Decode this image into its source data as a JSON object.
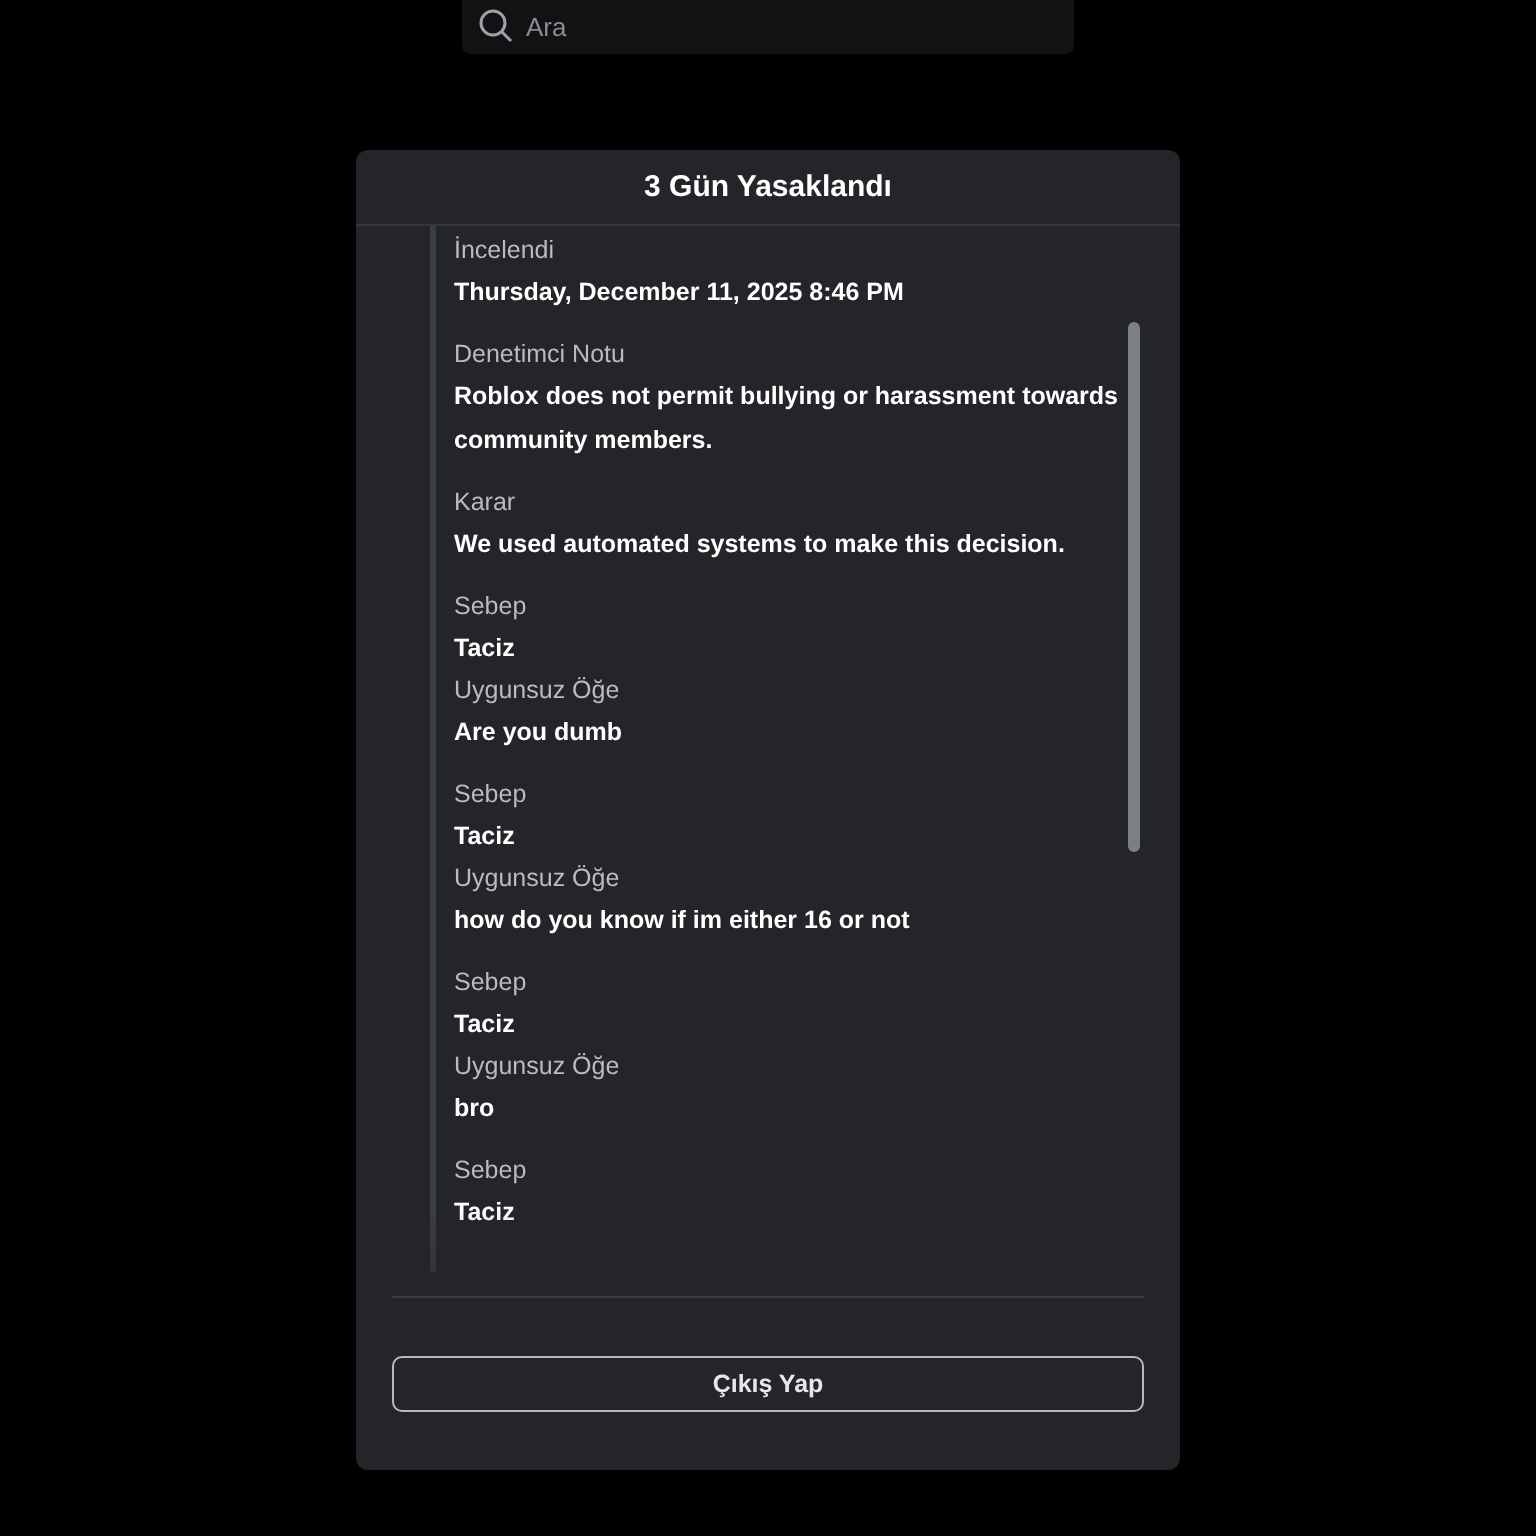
{
  "search": {
    "placeholder": "Ara"
  },
  "dialog": {
    "title": "3 Gün Yasaklandı",
    "groups": [
      {
        "fields": [
          {
            "label": "İncelendi",
            "value": "Thursday, December 11, 2025 8:46 PM"
          }
        ]
      },
      {
        "fields": [
          {
            "label": "Denetimci Notu",
            "value": "Roblox does not permit bullying or harassment towards community members."
          }
        ]
      },
      {
        "fields": [
          {
            "label": "Karar",
            "value": "We used automated systems to make this decision."
          }
        ]
      },
      {
        "fields": [
          {
            "label": "Sebep",
            "value": "Taciz"
          },
          {
            "label": "Uygunsuz Öğe",
            "value": "Are you dumb"
          }
        ]
      },
      {
        "fields": [
          {
            "label": "Sebep",
            "value": "Taciz"
          },
          {
            "label": "Uygunsuz Öğe",
            "value": "how do you know if im either 16 or not"
          }
        ]
      },
      {
        "fields": [
          {
            "label": "Sebep",
            "value": "Taciz"
          },
          {
            "label": "Uygunsuz Öğe",
            "value": "bro"
          }
        ]
      },
      {
        "fields": [
          {
            "label": "Sebep",
            "value": "Taciz"
          }
        ]
      }
    ],
    "button": "Çıkış Yap"
  }
}
